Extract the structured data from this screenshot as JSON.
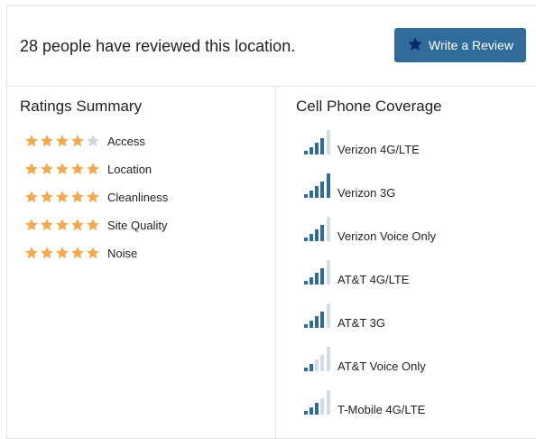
{
  "header": {
    "review_count_text": "28 people have reviewed this location.",
    "write_review_label": "Write a Review"
  },
  "ratings": {
    "title": "Ratings Summary",
    "items": [
      {
        "label": "Access",
        "stars": 4,
        "max": 5
      },
      {
        "label": "Location",
        "stars": 5,
        "max": 5
      },
      {
        "label": "Cleanliness",
        "stars": 5,
        "max": 5
      },
      {
        "label": "Site Quality",
        "stars": 5,
        "max": 5
      },
      {
        "label": "Noise",
        "stars": 5,
        "max": 5
      }
    ]
  },
  "coverage": {
    "title": "Cell Phone Coverage",
    "items": [
      {
        "label": "Verizon 4G/LTE",
        "bars": 4,
        "max": 5
      },
      {
        "label": "Verizon 3G",
        "bars": 5,
        "max": 5
      },
      {
        "label": "Verizon Voice Only",
        "bars": 4,
        "max": 5
      },
      {
        "label": "AT&T 4G/LTE",
        "bars": 4,
        "max": 5
      },
      {
        "label": "AT&T 3G",
        "bars": 4,
        "max": 5
      },
      {
        "label": "AT&T Voice Only",
        "bars": 2,
        "max": 5
      },
      {
        "label": "T-Mobile 4G/LTE",
        "bars": 3,
        "max": 5
      }
    ]
  },
  "colors": {
    "accent": "#2f6c9a",
    "star_filled": "#f3a94f",
    "star_empty": "#d6d6d6",
    "bar_filled": "#2f6c9a",
    "bar_empty": "#cfdde8"
  },
  "icons": {
    "review_button": "star-icon",
    "rating": "star-icon",
    "coverage": "signal-bars-icon"
  }
}
